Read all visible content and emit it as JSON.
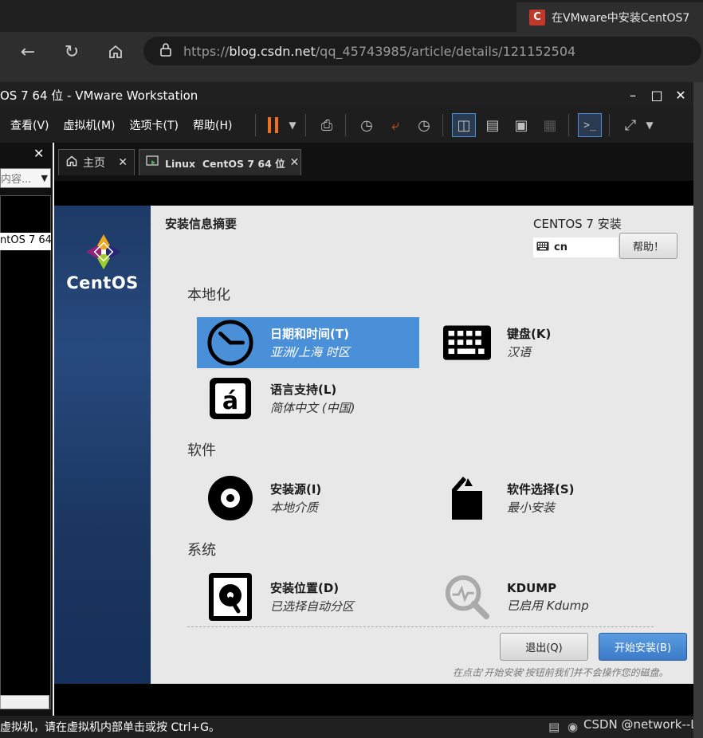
{
  "browser": {
    "tab_title": "在VMware中安装CentOS7",
    "tab_favicon": "C",
    "url_host": "blog.csdn.net",
    "url_path": "/qq_45743985/article/details/121152504",
    "url_scheme": "https://"
  },
  "vmware": {
    "window_title": "OS 7 64 位 - VMware Workstation",
    "menu": [
      "查看(V)",
      "虚拟机(M)",
      "选项卡(T)",
      "帮助(H)"
    ],
    "library_search_placeholder": "内容...",
    "library_item": "ntOS 7 64",
    "tabs": [
      {
        "label": "主页"
      },
      {
        "label": "Linux  CentOS 7 64 位"
      }
    ],
    "status_text": "虚拟机，请在虚拟机内部单击或按 Ctrl+G。"
  },
  "anaconda": {
    "brand": "CentOS",
    "summary_title": "安装信息摘要",
    "install_title": "CENTOS 7 安装",
    "keyboard_layout": "cn",
    "help_label": "帮助！",
    "sections": {
      "localization": "本地化",
      "software": "软件",
      "system": "系统"
    },
    "spokes": {
      "datetime": {
        "title": "日期和时间(T)",
        "status": "亚洲/上海 时区"
      },
      "keyboard": {
        "title": "键盘(K)",
        "status": "汉语"
      },
      "language": {
        "title": "语言支持(L)",
        "status": "简体中文 (中国)"
      },
      "source": {
        "title": "安装源(I)",
        "status": "本地介质"
      },
      "software_selection": {
        "title": "软件选择(S)",
        "status": "最小安装"
      },
      "destination": {
        "title": "安装位置(D)",
        "status": "已选择自动分区"
      },
      "kdump": {
        "title": "KDUMP",
        "status": "已启用 Kdump"
      }
    },
    "quit_label": "退出(Q)",
    "begin_label": "开始安装(B)",
    "warning": "在点击'开始安装'按钮前我们并不会操作您的磁盘。"
  },
  "watermark": "CSDN @network--L",
  "colors": {
    "selected_spoke": "#4a90d9",
    "begin_button": "#3b7bc9",
    "sidebar": "#1e3a66"
  }
}
